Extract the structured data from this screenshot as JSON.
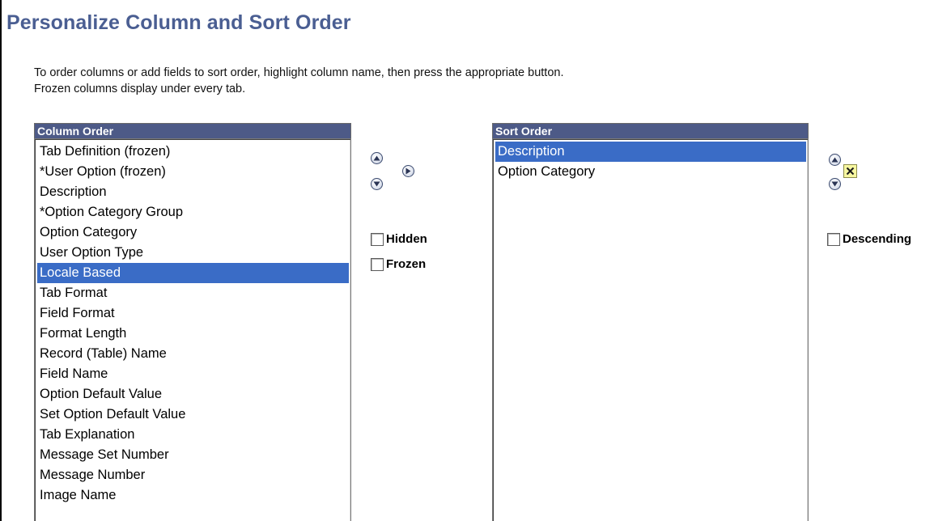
{
  "page": {
    "title": "Personalize Column and Sort Order",
    "instructions_line1": "To order columns or add fields to sort order, highlight column name, then press the appropriate button.",
    "instructions_line2": "Frozen columns display under every tab."
  },
  "column_order": {
    "header": "Column Order",
    "selected_index": 6,
    "items": [
      "Tab Definition (frozen)",
      "*User Option (frozen)",
      "Description",
      "*Option Category Group",
      "Option Category",
      "User Option Type",
      "Locale Based",
      "Tab Format",
      "Field Format",
      "Format Length",
      "Record (Table) Name",
      "Field Name",
      "Option Default Value",
      "Set Option Default Value",
      "Tab Explanation",
      "Message Set Number",
      "Message Number",
      "Image Name"
    ],
    "hidden_label": "Hidden",
    "frozen_label": "Frozen",
    "hidden_checked": false,
    "frozen_checked": false
  },
  "sort_order": {
    "header": "Sort Order",
    "selected_index": 0,
    "items": [
      "Description",
      "Option Category"
    ],
    "descending_label": "Descending",
    "descending_checked": false
  },
  "icons": {
    "move_up": "arrow-up-icon",
    "move_down": "arrow-down-icon",
    "add_to_sort": "arrow-right-icon",
    "remove": "x-delete-icon"
  },
  "colors": {
    "title": "#4a5e92",
    "header_bg": "#4d5a87",
    "selection": "#3a6cc6",
    "delete_bg": "#f7f7a0"
  }
}
